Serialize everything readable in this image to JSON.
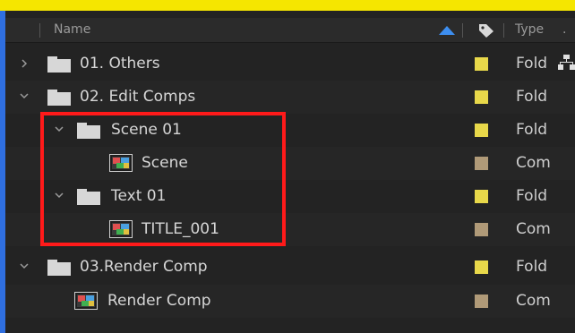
{
  "header": {
    "name": "Name",
    "type": "Type",
    "more": "."
  },
  "colors": {
    "folder_label": "#e8d84a",
    "comp_label": "#b09a78",
    "highlight": "#ff1a1a",
    "selection_border": "#2f6fe0",
    "sort_arrow": "#3d8ef0"
  },
  "rows": [
    {
      "name": "01. Others",
      "type": "Fold",
      "kind": "folder",
      "expanded": false,
      "depth": 0
    },
    {
      "name": "02. Edit Comps",
      "type": "Fold",
      "kind": "folder",
      "expanded": true,
      "depth": 0
    },
    {
      "name": "Scene 01",
      "type": "Fold",
      "kind": "folder",
      "expanded": true,
      "depth": 1
    },
    {
      "name": "Scene",
      "type": "Com",
      "kind": "composition",
      "depth": 2
    },
    {
      "name": "Text 01",
      "type": "Fold",
      "kind": "folder",
      "expanded": true,
      "depth": 1
    },
    {
      "name": "TITLE_001",
      "type": "Com",
      "kind": "composition",
      "depth": 2
    },
    {
      "name": "03.Render Comp",
      "type": "Fold",
      "kind": "folder",
      "expanded": true,
      "depth": 0
    },
    {
      "name": "Render Comp",
      "type": "Com",
      "kind": "composition",
      "depth": 1
    }
  ],
  "icons": {
    "network": "network-icon",
    "tag": "label-tag-icon",
    "sort": "sort-ascending-icon"
  }
}
